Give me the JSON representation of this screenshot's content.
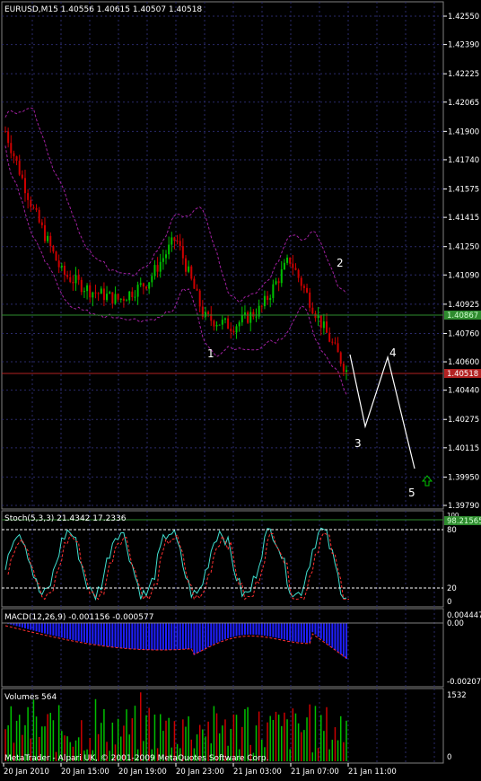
{
  "main": {
    "header": "EURUSD,M15  1.40556 1.40615 1.40507 1.40518",
    "price_ticks": [
      "1.42550",
      "1.42390",
      "1.42225",
      "1.42065",
      "1.41900",
      "1.41740",
      "1.41575",
      "1.41415",
      "1.41250",
      "1.41090",
      "1.40925",
      "1.40760",
      "1.40600",
      "1.40440",
      "1.40275",
      "1.40115",
      "1.39950",
      "1.39790"
    ],
    "level_label": "1.40867",
    "bid_label": "1.40518",
    "wave_labels": [
      "1",
      "2",
      "3",
      "4",
      "5"
    ]
  },
  "stoch": {
    "header": "Stoch(5,3,3) 21.4342 17.2336",
    "ticks": [
      "100",
      "80",
      "20",
      "0"
    ],
    "level_label": "98.21565"
  },
  "macd": {
    "header": "MACD(12,26,9) -0.001156 -0.000577",
    "ticks": [
      "0.004447",
      "0.00",
      "-0.002070"
    ]
  },
  "volumes": {
    "header": "Volumes 564",
    "ticks": [
      "1532",
      "0"
    ]
  },
  "footer": {
    "copyright": "MetaTrader - Alpari UK, © 2001-2009 MetaQuotes Software Corp.",
    "time_labels": [
      "20 Jan 2010",
      "20 Jan 15:00",
      "20 Jan 19:00",
      "20 Jan 23:00",
      "21 Jan 03:00",
      "21 Jan 07:00",
      "21 Jan 11:00"
    ]
  },
  "colors": {
    "bull": "#00c000",
    "bear": "#cc0000",
    "band": "#a020a0",
    "grid": "#2a2a6a",
    "level": "#2e8b2e",
    "bid": "#b22222",
    "stoch": "#40e0d0",
    "signal": "#ff3030",
    "macd": "#2020ff",
    "vol": "#00c000"
  },
  "chart_data": {
    "type": "candlestick",
    "symbol": "EURUSD",
    "timeframe": "M15",
    "x_range": [
      "20 Jan 2010",
      "21 Jan 11:00"
    ],
    "price_range": [
      1.3979,
      1.4255
    ],
    "close_path": [
      {
        "x": "20 Jan 2010",
        "close": 1.419
      },
      {
        "x": "20 Jan 13:00",
        "close": 1.4145
      },
      {
        "x": "20 Jan 15:00",
        "close": 1.411
      },
      {
        "x": "20 Jan 17:00",
        "close": 1.41
      },
      {
        "x": "20 Jan 19:00",
        "close": 1.4095
      },
      {
        "x": "20 Jan 23:00",
        "close": 1.4105
      },
      {
        "x": "21 Jan 00:00",
        "close": 1.413
      },
      {
        "x": "21 Jan 01:00",
        "close": 1.4085
      },
      {
        "x": "21 Jan 03:00",
        "close": 1.408
      },
      {
        "x": "21 Jan 05:00",
        "close": 1.409
      },
      {
        "x": "21 Jan 06:00",
        "close": 1.4118
      },
      {
        "x": "21 Jan 07:00",
        "close": 1.4085
      },
      {
        "x": "21 Jan 08:00",
        "close": 1.4055
      }
    ],
    "horizontal_levels": [
      1.40867,
      1.40518
    ],
    "elliott_projection": [
      {
        "label": "3",
        "price": 1.4026
      },
      {
        "label": "4",
        "price": 1.406
      },
      {
        "label": "5",
        "price": 1.3999
      }
    ],
    "stochastic": {
      "k": 21.4342,
      "d": 17.2336,
      "levels": [
        80,
        20
      ],
      "range": [
        0,
        100
      ]
    },
    "macd": {
      "main": -0.001156,
      "signal": -0.000577,
      "range": [
        -0.00207,
        0.004447
      ]
    },
    "volume": {
      "last": 564,
      "max": 1532
    }
  }
}
